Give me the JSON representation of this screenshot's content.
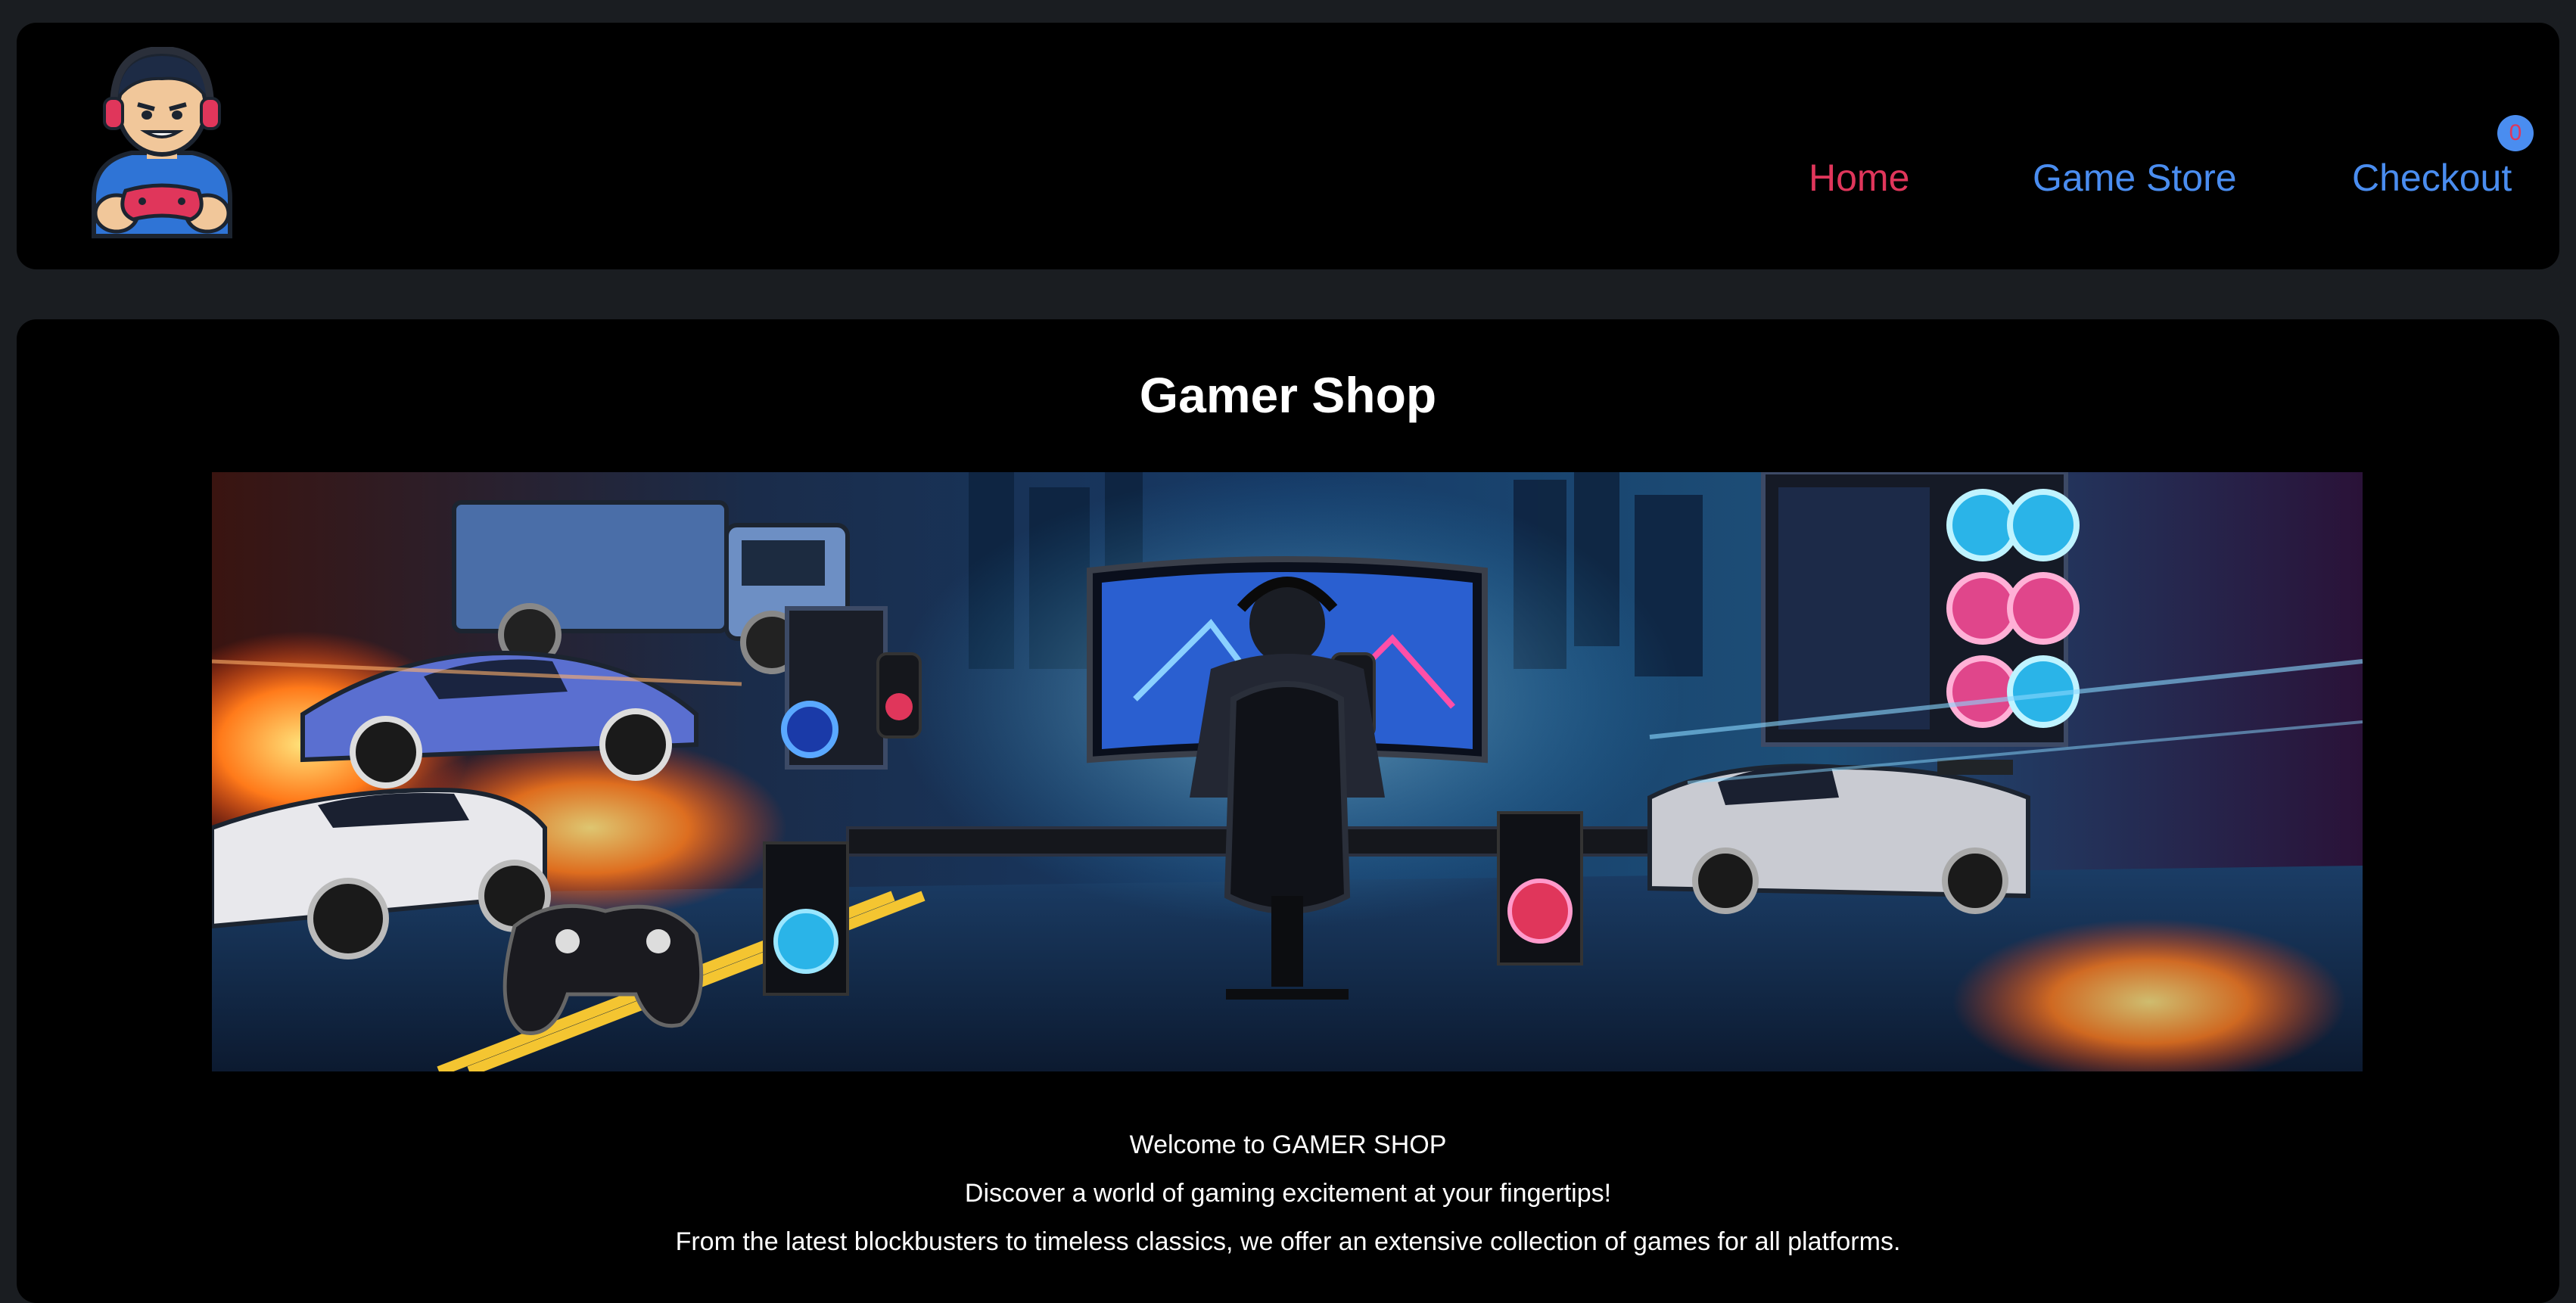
{
  "nav": {
    "home": "Home",
    "game_store": "Game Store",
    "checkout": "Checkout",
    "cart_count": "0"
  },
  "main": {
    "title": "Gamer Shop",
    "welcome": "Welcome to GAMER SHOP",
    "tagline": "Discover a world of gaming excitement at your fingertips!",
    "description": "From the latest blockbusters to timeless classics, we offer an extensive collection of games for all platforms."
  },
  "colors": {
    "page_background": "#1a1d21",
    "panel_background": "#000000",
    "active_link": "#e0365b",
    "link": "#4a8df0"
  }
}
